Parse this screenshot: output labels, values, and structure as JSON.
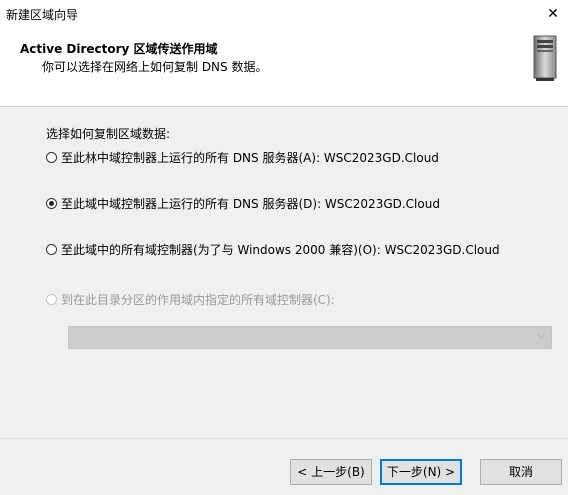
{
  "window": {
    "title": "新建区域向导",
    "close_glyph": "✕"
  },
  "header": {
    "title": "Active Directory 区域传送作用域",
    "subtitle": "你可以选择在网络上如何复制 DNS 数据。",
    "icon": "server-icon"
  },
  "form": {
    "prompt": "选择如何复制区域数据:",
    "options": [
      {
        "label": "至此林中域控制器上运行的所有 DNS 服务器(A): WSC2023GD.Cloud",
        "checked": false,
        "enabled": true
      },
      {
        "label": "至此域中域控制器上运行的所有 DNS 服务器(D): WSC2023GD.Cloud",
        "checked": true,
        "enabled": true
      },
      {
        "label": "至此域中的所有域控制器(为了与 Windows 2000 兼容)(O): WSC2023GD.Cloud",
        "checked": false,
        "enabled": true
      },
      {
        "label": "到在此目录分区的作用域内指定的所有域控制器(C):",
        "checked": false,
        "enabled": false
      }
    ],
    "partition_select": {
      "value": "",
      "enabled": false,
      "arrow_glyph": "⌵"
    }
  },
  "buttons": {
    "back": "< 上一步(B)",
    "next": "下一步(N) >",
    "cancel": "取消"
  }
}
